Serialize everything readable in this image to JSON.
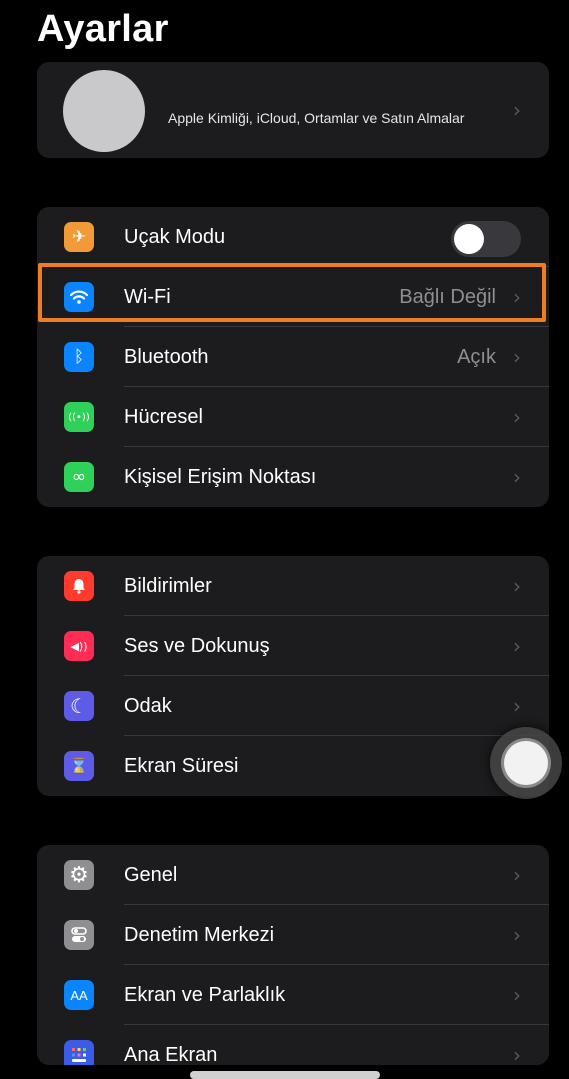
{
  "title": "Ayarlar",
  "account": {
    "text": "Apple Kimliği, iCloud, Ortamlar ve Satın Almalar",
    "chevron": "›"
  },
  "group1": [
    {
      "label": "Uçak Modu",
      "icon": "airplane-icon",
      "icon_glyph": "✈",
      "icon_color": "#f19a37",
      "toggle": "off"
    },
    {
      "label": "Wi-Fi",
      "value": "Bağlı Değil",
      "icon": "wifi-icon",
      "icon_glyph": "◠",
      "icon_color": "#0a84ff",
      "chevron": "›"
    },
    {
      "label": "Bluetooth",
      "value": "Açık",
      "icon": "bluetooth-icon",
      "icon_glyph": "ᛒ",
      "icon_color": "#0a84ff",
      "chevron": "›"
    },
    {
      "label": "Hücresel",
      "icon": "cellular-icon",
      "icon_glyph": "((•))",
      "icon_color": "#30d158",
      "chevron": "›"
    },
    {
      "label": "Kişisel Erişim Noktası",
      "icon": "hotspot-icon",
      "icon_glyph": "∞",
      "icon_color": "#30d158",
      "chevron": "›"
    }
  ],
  "group2": [
    {
      "label": "Bildirimler",
      "icon": "notifications-icon",
      "icon_glyph": "🔔",
      "icon_color": "#ff3b30",
      "chevron": "›"
    },
    {
      "label": "Ses ve Dokunuş",
      "icon": "sound-icon",
      "icon_glyph": "◀))",
      "icon_color": "#ff2d55",
      "chevron": "›"
    },
    {
      "label": "Odak",
      "icon": "moon-icon",
      "icon_glyph": "☾",
      "icon_color": "#5e5ce6",
      "chevron": "›"
    },
    {
      "label": "Ekran Süresi",
      "icon": "hourglass-icon",
      "icon_glyph": "⌛",
      "icon_color": "#5e5ce6"
    }
  ],
  "group3": [
    {
      "label": "Genel",
      "icon": "gear-icon",
      "icon_glyph": "⚙",
      "icon_color": "#8e8e93",
      "chevron": "›"
    },
    {
      "label": "Denetim Merkezi",
      "icon": "control-center-icon",
      "icon_glyph": "⊜",
      "icon_color": "#8e8e93",
      "chevron": "›"
    },
    {
      "label": "Ekran ve Parlaklık",
      "icon": "display-brightness-icon",
      "icon_glyph": "AA",
      "icon_color": "#0a84ff",
      "chevron": "›"
    },
    {
      "label": "Ana Ekran",
      "icon": "home-screen-icon",
      "icon_glyph": "▦",
      "icon_color": "#3a5ce6",
      "chevron": "›"
    }
  ],
  "colors": {
    "highlight": "#f07d22",
    "group_bg": "#1c1c1e",
    "background": "#000000"
  }
}
